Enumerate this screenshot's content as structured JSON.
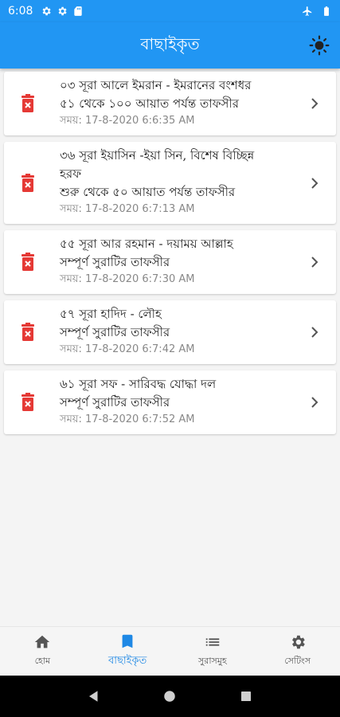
{
  "status_bar": {
    "time": "6:08"
  },
  "app_bar": {
    "title": "বাছাইকৃত"
  },
  "items": [
    {
      "lines": [
        "০৩ সূরা আলে ইমরান - ইমরানের বংশধর",
        "৫১ থেকে ১০০ আয়াত পর্যন্ত  তাফসীর"
      ],
      "time": "সময়: 17-8-2020 6:6:35 AM"
    },
    {
      "lines": [
        "৩৬ সূরা ইয়াসিন -ইয়া সিন, বিশেষ বিচ্ছিন্ন",
        "হরফ",
        "শুরু থেকে ৫০ আয়াত পর্যন্ত  তাফসীর"
      ],
      "time": "সময়: 17-8-2020 6:7:13 AM"
    },
    {
      "lines": [
        "৫৫ সূরা আর রহমান - দয়াময় আল্লাহ",
        "সম্পূর্ণ সুরাটির তাফসীর"
      ],
      "time": "সময়: 17-8-2020 6:7:30 AM"
    },
    {
      "lines": [
        "৫৭ সূরা হাদিদ - লৌহ",
        "সম্পূর্ণ সুরাটির তাফসীর"
      ],
      "time": "সময়: 17-8-2020 6:7:42 AM"
    },
    {
      "lines": [
        "৬১ সূরা সফ - সারিবদ্ধ যোদ্ধা দল",
        "সম্পূর্ণ সুরাটির তাফসীর"
      ],
      "time": "সময়: 17-8-2020 6:7:52 AM"
    }
  ],
  "bottom_nav": [
    {
      "label": "হোম",
      "icon": "home-icon",
      "active": false
    },
    {
      "label": "বাছাইকৃত",
      "icon": "bookmark-icon",
      "active": true
    },
    {
      "label": "সুরাসমুহ",
      "icon": "list-icon",
      "active": false
    },
    {
      "label": "সেটিংস",
      "icon": "gear-icon",
      "active": false
    }
  ],
  "colors": {
    "primary": "#2196f3",
    "active": "#1e88e5",
    "delete": "#e53935"
  }
}
